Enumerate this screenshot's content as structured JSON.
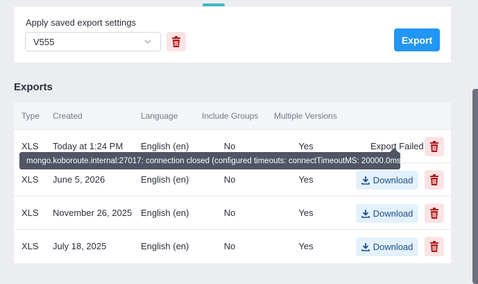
{
  "settings": {
    "label": "Apply saved export settings",
    "selected": "V555",
    "export_label": "Export"
  },
  "exports": {
    "title": "Exports",
    "columns": [
      "Type",
      "Created",
      "Language",
      "Include Groups",
      "Multiple Versions"
    ],
    "rows": [
      {
        "type": "XLS",
        "created": "Today at 1:24 PM",
        "language": "English (en)",
        "groups": "No",
        "versions": "Yes",
        "status": "Export Failed"
      },
      {
        "type": "XLS",
        "created": "June 5, 2026",
        "language": "English (en)",
        "groups": "No",
        "versions": "Yes",
        "action": "Download"
      },
      {
        "type": "XLS",
        "created": "November 26, 2025",
        "language": "English (en)",
        "groups": "No",
        "versions": "Yes",
        "action": "Download"
      },
      {
        "type": "XLS",
        "created": "July 18, 2025",
        "language": "English (en)",
        "groups": "No",
        "versions": "Yes",
        "action": "Download"
      }
    ]
  },
  "tooltip": {
    "text": "mongo.koboroute.internal:27017: connection closed (configured timeouts: connectTimeoutMS: 20000.0ms)"
  },
  "colors": {
    "accent": "#2196f3",
    "danger": "#b01717",
    "danger_bg": "#fbe3e3",
    "download_bg": "#e3f1fd",
    "tab_indicator": "#3fb6c9"
  },
  "icons": {
    "trash": "trash-icon",
    "download": "download-icon",
    "chevron": "chevron-down-icon"
  }
}
